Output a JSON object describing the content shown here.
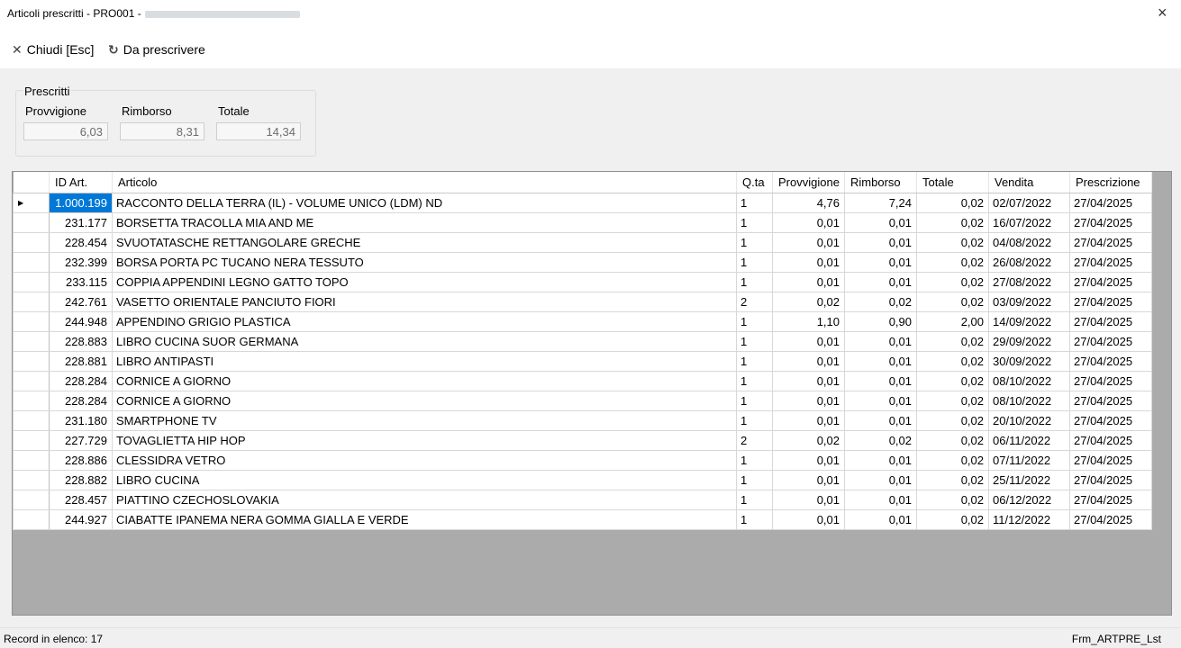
{
  "window": {
    "title": "Articoli prescritti - PRO001 -"
  },
  "toolbar": {
    "close_label": "Chiudi [Esc]",
    "prescribe_label": "Da prescrivere"
  },
  "totals": {
    "group_label": "Prescritti",
    "fields": [
      {
        "label": "Provvigione",
        "value": "6,03"
      },
      {
        "label": "Rimborso",
        "value": "8,31"
      },
      {
        "label": "Totale",
        "value": "14,34"
      }
    ]
  },
  "grid": {
    "columns": [
      "ID Art.",
      "Articolo",
      "Q.ta",
      "Provvigione",
      "Rimborso",
      "Totale",
      "Vendita",
      "Prescrizione"
    ],
    "rows": [
      [
        "1.000.199",
        "RACCONTO DELLA TERRA (IL) - VOLUME UNICO (LDM) ND",
        "1",
        "4,76",
        "7,24",
        "0,02",
        "02/07/2022",
        "27/04/2025"
      ],
      [
        "231.177",
        "BORSETTA TRACOLLA MIA AND ME",
        "1",
        "0,01",
        "0,01",
        "0,02",
        "16/07/2022",
        "27/04/2025"
      ],
      [
        "228.454",
        "SVUOTATASCHE RETTANGOLARE GRECHE",
        "1",
        "0,01",
        "0,01",
        "0,02",
        "04/08/2022",
        "27/04/2025"
      ],
      [
        "232.399",
        "BORSA PORTA PC TUCANO NERA TESSUTO",
        "1",
        "0,01",
        "0,01",
        "0,02",
        "26/08/2022",
        "27/04/2025"
      ],
      [
        "233.115",
        "COPPIA APPENDINI LEGNO GATTO TOPO",
        "1",
        "0,01",
        "0,01",
        "0,02",
        "27/08/2022",
        "27/04/2025"
      ],
      [
        "242.761",
        "VASETTO ORIENTALE PANCIUTO FIORI",
        "2",
        "0,02",
        "0,02",
        "0,02",
        "03/09/2022",
        "27/04/2025"
      ],
      [
        "244.948",
        "APPENDINO GRIGIO PLASTICA",
        "1",
        "1,10",
        "0,90",
        "2,00",
        "14/09/2022",
        "27/04/2025"
      ],
      [
        "228.883",
        "LIBRO CUCINA SUOR GERMANA",
        "1",
        "0,01",
        "0,01",
        "0,02",
        "29/09/2022",
        "27/04/2025"
      ],
      [
        "228.881",
        "LIBRO ANTIPASTI",
        "1",
        "0,01",
        "0,01",
        "0,02",
        "30/09/2022",
        "27/04/2025"
      ],
      [
        "228.284",
        "CORNICE A GIORNO",
        "1",
        "0,01",
        "0,01",
        "0,02",
        "08/10/2022",
        "27/04/2025"
      ],
      [
        "228.284",
        "CORNICE A GIORNO",
        "1",
        "0,01",
        "0,01",
        "0,02",
        "08/10/2022",
        "27/04/2025"
      ],
      [
        "231.180",
        "SMARTPHONE TV",
        "1",
        "0,01",
        "0,01",
        "0,02",
        "20/10/2022",
        "27/04/2025"
      ],
      [
        "227.729",
        "TOVAGLIETTA HIP HOP",
        "2",
        "0,02",
        "0,02",
        "0,02",
        "06/11/2022",
        "27/04/2025"
      ],
      [
        "228.886",
        "CLESSIDRA VETRO",
        "1",
        "0,01",
        "0,01",
        "0,02",
        "07/11/2022",
        "27/04/2025"
      ],
      [
        "228.882",
        "LIBRO CUCINA",
        "1",
        "0,01",
        "0,01",
        "0,02",
        "25/11/2022",
        "27/04/2025"
      ],
      [
        "228.457",
        "PIATTINO CZECHOSLOVAKIA",
        "1",
        "0,01",
        "0,01",
        "0,02",
        "06/12/2022",
        "27/04/2025"
      ],
      [
        "244.927",
        "CIABATTE IPANEMA NERA GOMMA GIALLA E VERDE",
        "1",
        "0,01",
        "0,01",
        "0,02",
        "11/12/2022",
        "27/04/2025"
      ]
    ]
  },
  "status": {
    "left": "Record in elenco: 17",
    "right": "Frm_ARTPRE_Lst"
  },
  "icons": {
    "close_window": "×",
    "close_toolbar": "✕",
    "prescribe": "↻",
    "row_pointer": "▶"
  },
  "colors": {
    "selection": "#0078d7",
    "grid_background": "#ababab"
  }
}
